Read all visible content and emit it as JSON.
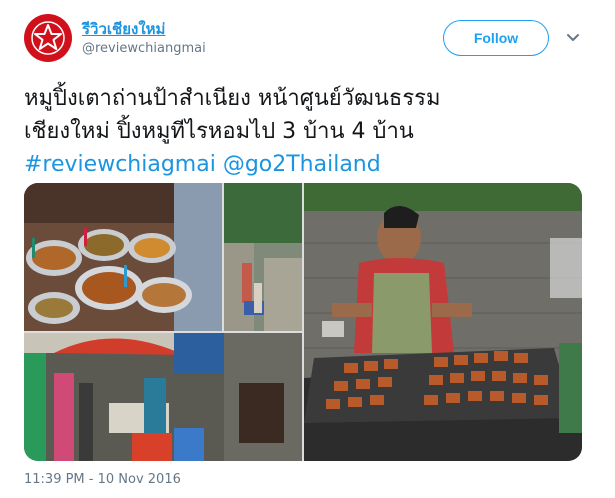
{
  "user": {
    "display_name": "รีวิวเชียงใหม่",
    "handle": "@reviewchiangmai",
    "avatar_color": "#d0111b"
  },
  "follow_label": "Follow",
  "tweet": {
    "line1": "หมูปิ้งเตาถ่านป้าสำเนียง หน้าศูนย์วัฒนธรรม",
    "line2": "เชียงใหม่ ปิ้งหมูทีไรหอมไป 3 บ้าน 4 บ้าน",
    "hashtag1": "#reviewchiagmai",
    "hashtag2": "@go2Thailand"
  },
  "timestamp": "11:39 PM - 10 Nov 2016",
  "colors": {
    "link": "#1b95e0",
    "follow": "#1da1f2",
    "muted": "#657786"
  },
  "icons": {
    "avatar": "star-icon",
    "caret": "chevron-down-icon"
  }
}
